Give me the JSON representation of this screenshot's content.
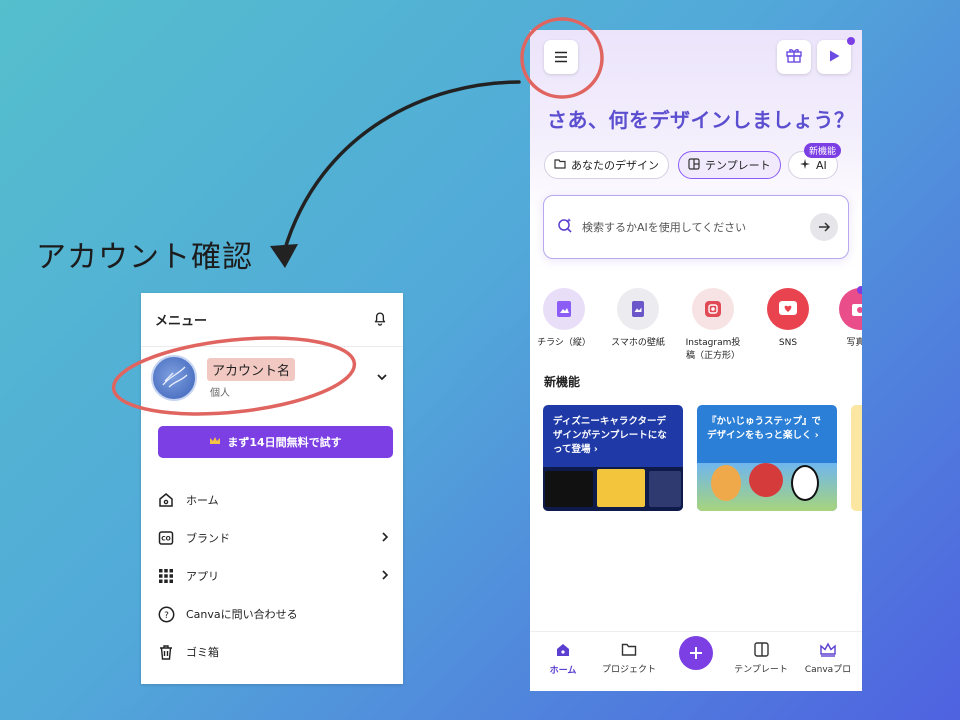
{
  "caption": "アカウント確認",
  "menu": {
    "title": "メニュー",
    "account": {
      "name": "アカウント名",
      "type": "個人"
    },
    "trial_label": "まず14日間無料で試す",
    "items": [
      {
        "label": "ホーム",
        "icon": "home-icon",
        "has_chevron": false
      },
      {
        "label": "ブランド",
        "icon": "brand-icon",
        "has_chevron": true
      },
      {
        "label": "アプリ",
        "icon": "apps-grid-icon",
        "has_chevron": true
      },
      {
        "label": "Canvaに問い合わせる",
        "icon": "help-icon",
        "has_chevron": false
      },
      {
        "label": "ゴミ箱",
        "icon": "trash-icon",
        "has_chevron": false
      }
    ]
  },
  "phone": {
    "headline": "さあ、何をデザインしましょう？",
    "chips": [
      {
        "label": "あなたのデザイン",
        "icon": "folder-icon",
        "active": false
      },
      {
        "label": "テンプレート",
        "icon": "template-icon",
        "active": true
      },
      {
        "label": "AI",
        "icon": "sparkle-icon",
        "active": false
      }
    ],
    "new_badge": "新機能",
    "search_placeholder": "検索するかAIを使用してください",
    "quick_actions": [
      {
        "label": "チラシ（縦）",
        "color": "#e8def8",
        "icon_color": "#8b5cf6"
      },
      {
        "label": "スマホの壁紙",
        "color": "#ececf0",
        "icon_color": "#6b57c9"
      },
      {
        "label": "Instagram投\n稿（正方形）",
        "color": "#f7e3e3",
        "icon_color": "#e14b55"
      },
      {
        "label": "SNS",
        "color": "#e8434f",
        "icon_color": "#ffffff"
      },
      {
        "label": "写真エ",
        "color": "#e94d8a",
        "icon_color": "#ffffff"
      }
    ],
    "section_title": "新機能",
    "cards": [
      {
        "text": "ディズニーキャラクターデザインがテンプレートになって登場 ›",
        "bg": "#1f3aa6",
        "fg": "#ffffff"
      },
      {
        "text": "『かいじゅうステップ』でデザインをもっと楽しく ›",
        "bg": "#2b7fd6",
        "fg": "#ffffff"
      }
    ],
    "nav": [
      {
        "label": "ホーム",
        "icon": "home-icon",
        "active": true
      },
      {
        "label": "プロジェクト",
        "icon": "folder-icon",
        "active": false
      },
      {
        "label": "テンプレート",
        "icon": "template-icon",
        "active": false
      },
      {
        "label": "Canvaプロ",
        "icon": "crown-icon",
        "active": false
      }
    ]
  },
  "colors": {
    "accent": "#7b3fe4",
    "highlight_ellipse": "#e0645f"
  }
}
